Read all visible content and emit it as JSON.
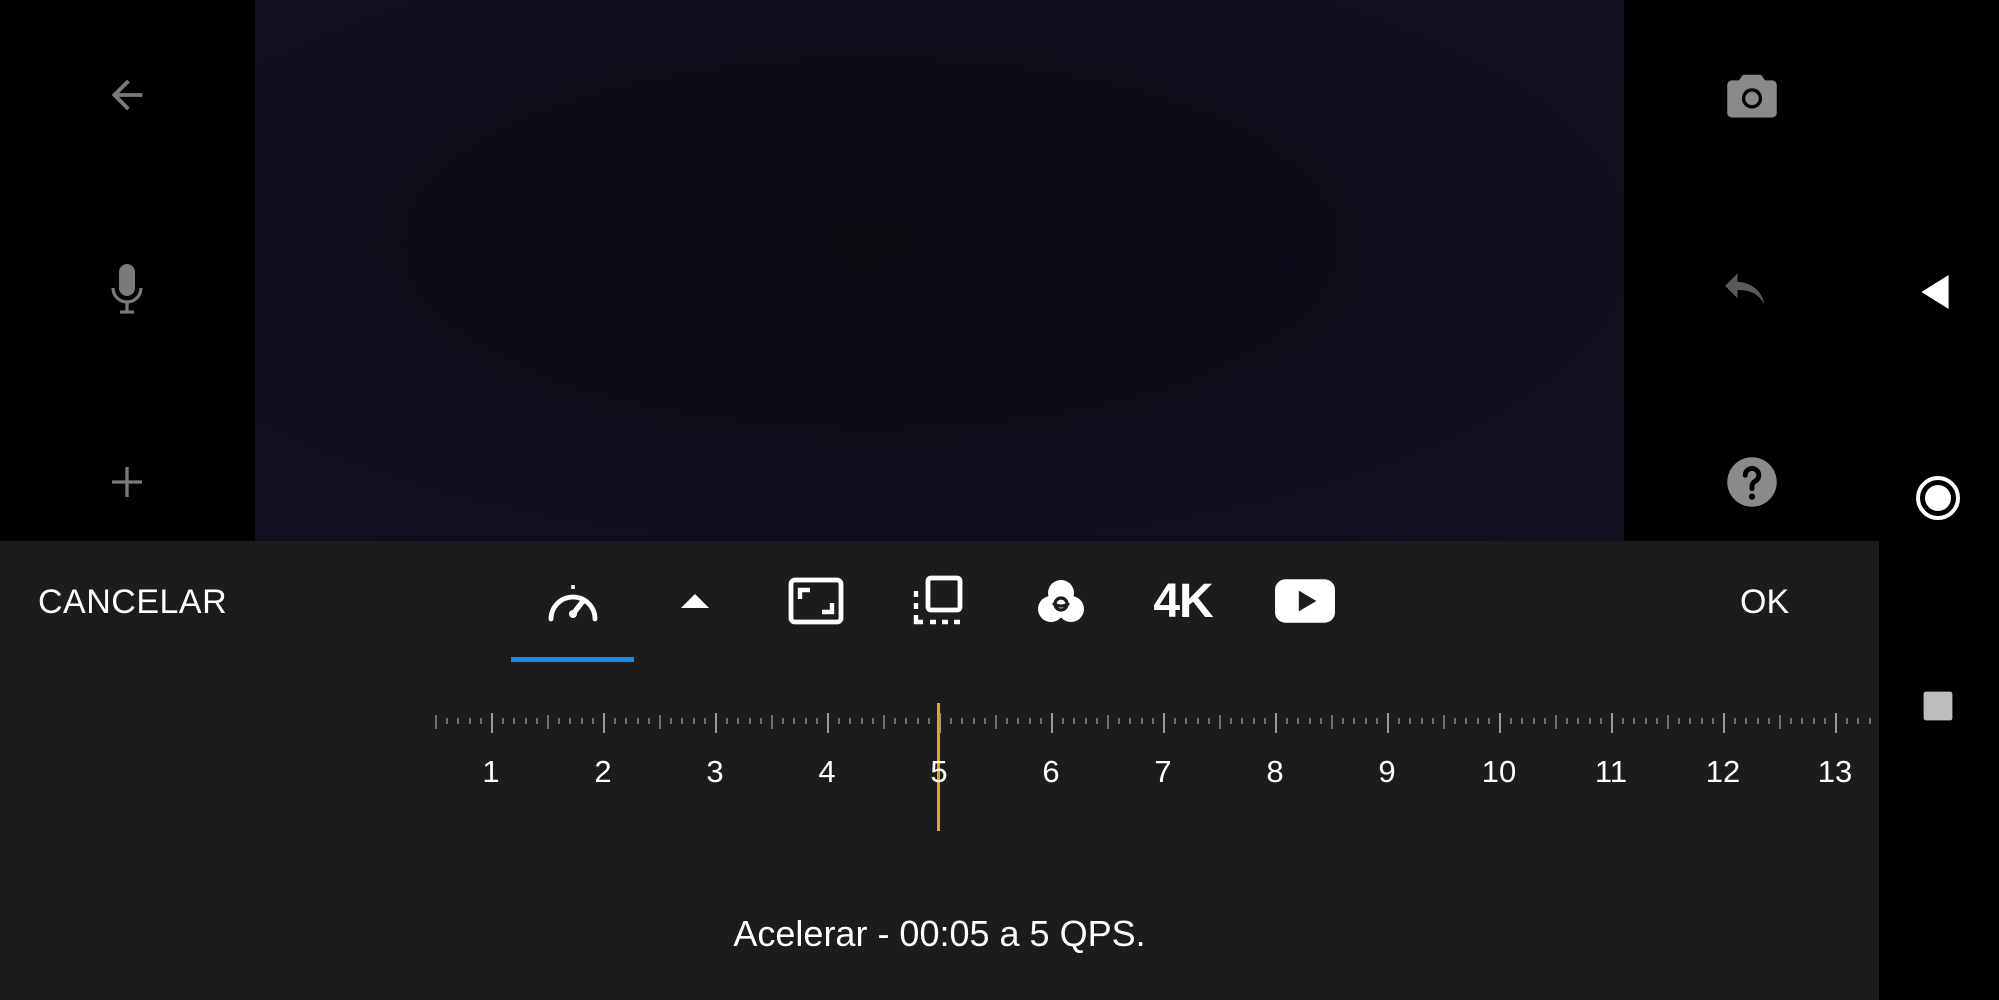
{
  "left_rail": {
    "back_icon": "arrow-left-icon",
    "mic_icon": "microphone-icon",
    "add_icon": "plus-icon"
  },
  "right_rail": {
    "camera_icon": "camera-icon",
    "undo_icon": "undo-icon",
    "help_icon": "help-icon"
  },
  "system_nav": {
    "back_icon": "triangle-back-icon",
    "home_icon": "circle-home-icon",
    "recents_icon": "square-recents-icon"
  },
  "toolbar": {
    "cancel_label": "CANCELAR",
    "ok_label": "OK",
    "tools": [
      {
        "name": "speed",
        "icon": "speedometer-icon",
        "active": true
      },
      {
        "name": "expand",
        "icon": "chevron-up-icon"
      },
      {
        "name": "aspect",
        "icon": "aspect-ratio-icon"
      },
      {
        "name": "crop",
        "icon": "crop-select-icon"
      },
      {
        "name": "filters",
        "icon": "color-filter-icon"
      },
      {
        "name": "resolution",
        "label": "4K"
      },
      {
        "name": "youtube",
        "icon": "youtube-icon"
      }
    ],
    "accent_color": "#1e88e5"
  },
  "timeline": {
    "labels": [
      "1",
      "2",
      "3",
      "4",
      "5",
      "6",
      "7",
      "8",
      "9",
      "10",
      "11",
      "12",
      "13"
    ],
    "playhead_value": 5,
    "playhead_color": "#e0a526"
  },
  "status": {
    "text": "Acelerar - 00:05 a 5 QPS."
  }
}
